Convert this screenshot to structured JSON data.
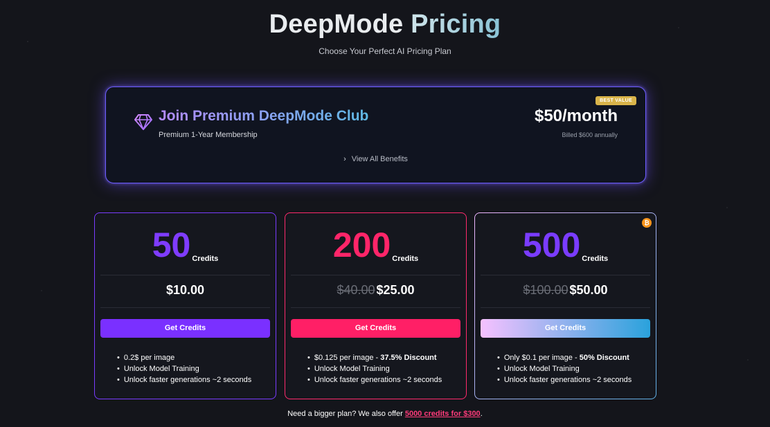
{
  "header": {
    "title_part1": "DeepMode",
    "title_part2": "Pricing",
    "subtitle": "Choose Your Perfect AI Pricing Plan"
  },
  "premium": {
    "title": "Join Premium DeepMode Club",
    "subtitle": "Premium 1-Year Membership",
    "badge": "BEST VALUE",
    "price": "$50/month",
    "billed": "Billed $600 annually",
    "benefits_link": "View All Benefits"
  },
  "plans": [
    {
      "credits": "50",
      "credits_label": "Credits",
      "old_price": "",
      "price": "$10.00",
      "button": "Get Credits",
      "features": [
        "0.2$ per image",
        "Unlock Model Training",
        "Unlock faster generations ~2 seconds"
      ],
      "color": "#7f3cff"
    },
    {
      "credits": "200",
      "credits_label": "Credits",
      "old_price": "$40.00",
      "price": "$25.00",
      "button": "Get Credits",
      "features_first_prefix": "$0.125 per image - ",
      "features_first_bold": "37.5% Discount",
      "features": [
        "Unlock Model Training",
        "Unlock faster generations ~2 seconds"
      ],
      "color": "#ff2569"
    },
    {
      "credits": "500",
      "credits_label": "Credits",
      "old_price": "$100.00",
      "price": "$50.00",
      "button": "Get Credits",
      "badge_icon": "bitcoin-icon",
      "badge_glyph": "₿",
      "features_first_prefix": "Only $0.1 per image - ",
      "features_first_bold": "50% Discount",
      "features": [
        "Unlock Model Training",
        "Unlock faster generations ~2 seconds"
      ],
      "color": "#7a3cff"
    }
  ],
  "footer": {
    "text": "Need a bigger plan? We also offer ",
    "link": "5000 credits for $300",
    "suffix": "."
  },
  "colors": {
    "background": "#14151b",
    "premium_border": "#6b5cff",
    "badge": "#d9b44a",
    "link": "#ff3b7a"
  }
}
